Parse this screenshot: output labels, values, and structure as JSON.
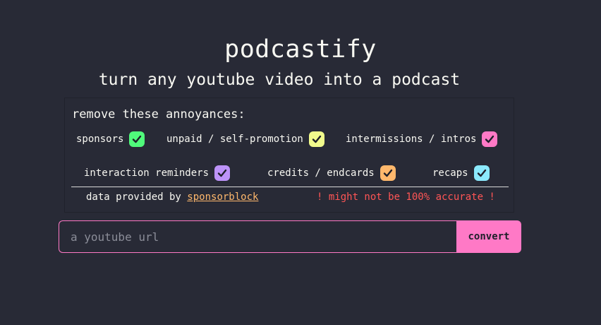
{
  "header": {
    "title": "podcastify",
    "subtitle": "turn any youtube video into a podcast"
  },
  "options": {
    "heading": "remove these annoyances:",
    "items": [
      {
        "label": "sponsors",
        "checked": true,
        "color": "#50fa7b"
      },
      {
        "label": "unpaid / self-promotion",
        "checked": true,
        "color": "#f1fa8c"
      },
      {
        "label": "intermissions / intros",
        "checked": true,
        "color": "#ff79c6"
      },
      {
        "label": "interaction reminders",
        "checked": true,
        "color": "#bd93f9"
      },
      {
        "label": "credits / endcards",
        "checked": true,
        "color": "#ffb86c"
      },
      {
        "label": "recaps",
        "checked": true,
        "color": "#8be9fd"
      }
    ],
    "credit_prefix": "data provided by",
    "credit_link": "sponsorblock",
    "warning": "! might not be 100% accurate !"
  },
  "form": {
    "placeholder": "a youtube url",
    "value": "",
    "button_label": "convert"
  },
  "colors": {
    "background": "#282a36",
    "accent": "#ff79c6",
    "warning": "#ff5555",
    "link": "#ffb86c"
  }
}
